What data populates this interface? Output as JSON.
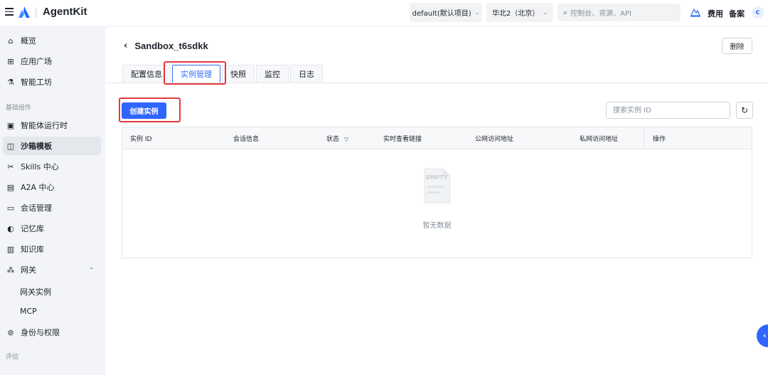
{
  "brand": {
    "name": "AgentKit"
  },
  "header": {
    "project": "default(默认项目)",
    "region": "华北2（北京）",
    "search_placeholder": "控制台、资源、API",
    "cost": "费用",
    "filing": "备案",
    "avatar": "c"
  },
  "sidebar": {
    "top_items": [
      {
        "label": "概览"
      },
      {
        "label": "应用广场"
      },
      {
        "label": "智能工坊"
      }
    ],
    "group_label": "基础组件",
    "items": [
      {
        "label": "智能体运行时"
      },
      {
        "label": "沙箱模板",
        "active": true
      },
      {
        "label": "Skills 中心"
      },
      {
        "label": "A2A 中心"
      },
      {
        "label": "会话管理"
      },
      {
        "label": "记忆库"
      },
      {
        "label": "知识库"
      },
      {
        "label": "网关"
      }
    ],
    "gateway_sub": [
      {
        "label": "网关实例"
      },
      {
        "label": "MCP"
      }
    ],
    "identity": {
      "label": "身份与权限"
    },
    "bottom_group_label": "评估"
  },
  "page": {
    "title": "Sandbox_t6sdkk",
    "delete_label": "删除",
    "tabs": [
      {
        "label": "配置信息"
      },
      {
        "label": "实例管理",
        "active": true
      },
      {
        "label": "快照"
      },
      {
        "label": "监控"
      },
      {
        "label": "日志"
      }
    ],
    "create_label": "创建实例",
    "search_placeholder": "搜索实例 ID",
    "columns": [
      {
        "label": "实例 ID"
      },
      {
        "label": "会话信息"
      },
      {
        "label": "状态"
      },
      {
        "label": "实时查看链接"
      },
      {
        "label": "公网访问地址"
      },
      {
        "label": "私网访问地址"
      },
      {
        "label": "操作"
      }
    ],
    "empty_image_text": "EMPTY",
    "empty_text": "暂无数据"
  },
  "colors": {
    "primary": "#2f66ff",
    "highlight": "#e5383b",
    "active_tab": "#3370ff"
  }
}
